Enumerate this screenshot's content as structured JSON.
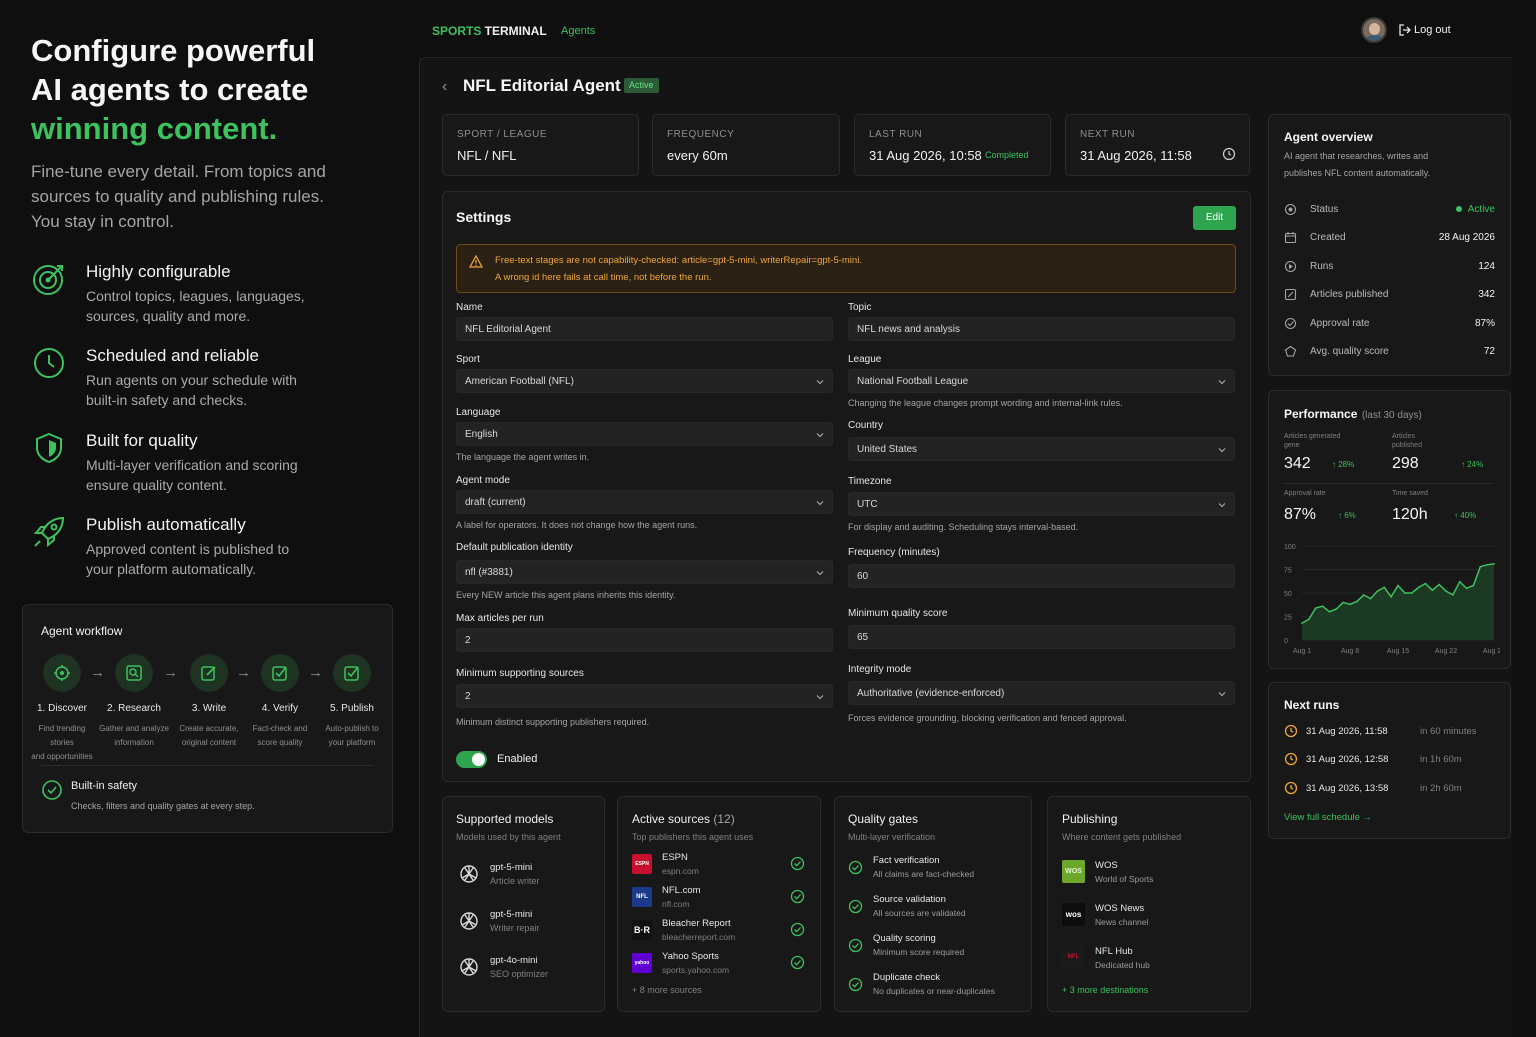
{
  "hero": {
    "line1": "Configure powerful",
    "line2": "AI agents to create",
    "line3": "winning content.",
    "subtitle_l1": "Fine-tune every detail. From topics and",
    "subtitle_l2": "sources to quality and publishing rules.",
    "subtitle_l3": "You stay in control."
  },
  "features": [
    {
      "title": "Highly configurable",
      "d1": "Control topics, leagues, languages,",
      "d2": "sources, quality and more.",
      "icon": "target-icon"
    },
    {
      "title": "Scheduled and reliable",
      "d1": "Run agents on your schedule with",
      "d2": "built-in safety and checks.",
      "icon": "clock-icon"
    },
    {
      "title": "Built for quality",
      "d1": "Multi-layer verification and scoring",
      "d2": "ensure quality content.",
      "icon": "shield-icon"
    },
    {
      "title": "Publish automatically",
      "d1": "Approved content is published to",
      "d2": "your platform automatically.",
      "icon": "rocket-icon"
    }
  ],
  "workflow": {
    "title": "Agent workflow",
    "steps": [
      {
        "title": "1. Discover",
        "d1": "Find trending stories",
        "d2": "and opportunities"
      },
      {
        "title": "2. Research",
        "d1": "Gather and analyze",
        "d2": "information"
      },
      {
        "title": "3. Write",
        "d1": "Create accurate,",
        "d2": "original content"
      },
      {
        "title": "4. Verify",
        "d1": "Fact-check and",
        "d2": "score quality"
      },
      {
        "title": "5. Publish",
        "d1": "Auto-publish to",
        "d2": "your platform"
      }
    ],
    "safety_title": "Built-in safety",
    "safety_desc": "Checks, filters and quality gates at every step."
  },
  "nav": {
    "brand_a": "SPORTS",
    "brand_b": " TERMINAL",
    "agents": "Agents",
    "logout": "Log out"
  },
  "agent": {
    "title": "NFL Editorial Agent",
    "badge": "Active"
  },
  "stats": [
    {
      "k": "SPORT / LEAGUE",
      "v": "NFL / NFL"
    },
    {
      "k": "FREQUENCY",
      "v": "every 60m"
    },
    {
      "k": "LAST RUN",
      "v": "31 Aug 2026, 10:58",
      "extra": "Completed"
    },
    {
      "k": "NEXT RUN",
      "v": "31 Aug 2026, 11:58"
    }
  ],
  "settings": {
    "title": "Settings",
    "edit": "Edit",
    "warning_l1": "Free-text stages are not capability-checked: article=gpt-5-mini, writerRepair=gpt-5-mini.",
    "warning_l2": "A wrong id here fails at call time, not before the run.",
    "name_label": "Name",
    "name_value": "NFL Editorial Agent",
    "topic_label": "Topic",
    "topic_value": "NFL news and analysis",
    "sport_label": "Sport",
    "sport_value": "American Football (NFL)",
    "league_label": "League",
    "league_value": "National Football League",
    "league_help": "Changing the league changes prompt wording and internal-link rules.",
    "language_label": "Language",
    "language_value": "English",
    "language_help": "The language the agent writes in.",
    "country_label": "Country",
    "country_value": "United States",
    "mode_label": "Agent mode",
    "mode_value": "draft (current)",
    "mode_help": "A label for operators. It does not change how the agent runs.",
    "tz_label": "Timezone",
    "tz_value": "UTC",
    "tz_help": "For display and auditing. Scheduling stays interval-based.",
    "identity_label": "Default publication identity",
    "identity_value": "nfl (#3881)",
    "identity_help": "Every NEW article this agent plans inherits this identity.",
    "freq_label": "Frequency (minutes)",
    "freq_value": "60",
    "max_label": "Max articles per run",
    "max_value": "2",
    "minq_label": "Minimum quality score",
    "minq_value": "65",
    "minsrc_label": "Minimum supporting sources",
    "minsrc_value": "2",
    "minsrc_help": "Minimum distinct supporting publishers required.",
    "integrity_label": "Integrity mode",
    "integrity_value": "Authoritative (evidence-enforced)",
    "integrity_help": "Forces evidence grounding, blocking verification and fenced approval.",
    "enabled": "Enabled"
  },
  "overview": {
    "title": "Agent overview",
    "desc_l1": "AI agent that researches, writes and",
    "desc_l2": "publishes NFL content automatically.",
    "rows": [
      {
        "label": "Status",
        "value": "Active",
        "icon": "status-icon"
      },
      {
        "label": "Created",
        "value": "28 Aug 2026",
        "icon": "calendar-icon"
      },
      {
        "label": "Runs",
        "value": "124",
        "icon": "runs-icon"
      },
      {
        "label": "Articles published",
        "value": "342",
        "icon": "article-icon"
      },
      {
        "label": "Approval rate",
        "value": "87%",
        "icon": "check-icon"
      },
      {
        "label": "Avg. quality score",
        "value": "72",
        "icon": "quality-icon"
      }
    ]
  },
  "performance": {
    "title": "Performance",
    "period": "(last 30 days)",
    "m1_label_l1": "Articles generated",
    "m1_label_l2": "gene",
    "m1_value": "342",
    "m1_delta": "↑ 28%",
    "m2_label_l1": "Articles",
    "m2_label_l2": "published",
    "m2_value": "298",
    "m2_delta": "↑ 24%",
    "m3_label": "Approval rate",
    "m3_value": "87%",
    "m3_delta": "↑ 6%",
    "m4_label": "Time saved",
    "m4_value": "120h",
    "m4_delta": "↑ 40%"
  },
  "chart_data": {
    "type": "area",
    "x": [
      "Aug 1",
      "Aug 8",
      "Aug 15",
      "Aug 22",
      "Aug 29"
    ],
    "yticks": [
      0,
      25,
      50,
      75,
      100
    ],
    "ylim": [
      0,
      100
    ],
    "values": [
      18,
      22,
      34,
      36,
      30,
      33,
      40,
      38,
      41,
      48,
      44,
      52,
      56,
      46,
      58,
      50,
      50,
      56,
      60,
      53,
      59,
      52,
      48,
      62,
      55,
      58,
      78,
      80,
      81
    ]
  },
  "next_runs": {
    "title": "Next runs",
    "runs": [
      {
        "time": "31 Aug 2026, 11:58",
        "rel": "in 60 minutes"
      },
      {
        "time": "31 Aug 2026, 12:58",
        "rel": "in 1h 60m"
      },
      {
        "time": "31 Aug 2026, 13:58",
        "rel": "in 2h 60m"
      }
    ],
    "link": "View full schedule →"
  },
  "models": {
    "title": "Supported models",
    "sub": "Models used by this agent",
    "items": [
      {
        "name": "gpt-5-mini",
        "role": "Article writer"
      },
      {
        "name": "gpt-5-mini",
        "role": "Writer repair"
      },
      {
        "name": "gpt-4o-mini",
        "role": "SEO optimizer"
      }
    ]
  },
  "sources": {
    "title": "Active sources",
    "count": "(12)",
    "sub": "Top publishers this agent uses",
    "items": [
      {
        "name": "ESPN",
        "domain": "espn.com",
        "logo": "ESPN"
      },
      {
        "name": "NFL.com",
        "domain": "nfl.com",
        "logo": "NFL"
      },
      {
        "name": "Bleacher Report",
        "domain": "bleacherreport.com",
        "logo": "B·R"
      },
      {
        "name": "Yahoo Sports",
        "domain": "sports.yahoo.com",
        "logo": "yahoo"
      }
    ],
    "more": "+ 8 more sources"
  },
  "gates": {
    "title": "Quality gates",
    "sub": "Multi-layer verification",
    "items": [
      {
        "name": "Fact verification",
        "desc": "All claims are fact-checked"
      },
      {
        "name": "Source validation",
        "desc": "All sources are validated"
      },
      {
        "name": "Quality scoring",
        "desc": "Minimum score required"
      },
      {
        "name": "Duplicate check",
        "desc": "No duplicates or near-duplicates"
      }
    ]
  },
  "publishing": {
    "title": "Publishing",
    "sub": "Where content gets published",
    "items": [
      {
        "name": "WOS",
        "desc": "World of Sports",
        "logo": "WOS"
      },
      {
        "name": "WOS News",
        "desc": "News channel",
        "logo": "wos"
      },
      {
        "name": "NFL Hub",
        "desc": "Dedicated hub",
        "logo": "NFL"
      }
    ],
    "more": "+ 3 more destinations"
  }
}
